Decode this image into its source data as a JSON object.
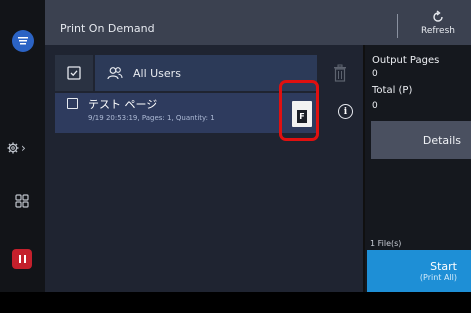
{
  "header": {
    "title": "Print On Demand",
    "refresh_label": "Refresh"
  },
  "rail": {
    "home_icon": "app-home-icon",
    "settings_icon": "gear-icon",
    "apps_icon": "apps-grid-icon",
    "stop_icon": "stop-pause-icon"
  },
  "toolbar": {
    "select_all_icon": "select-all-checkbox-icon",
    "user_filter_icon": "users-icon",
    "user_filter_label": "All Users",
    "delete_icon": "trash-icon"
  },
  "job": {
    "name": "テスト ページ",
    "details": "9/19 20:53:19, Pages: 1, Quantity: 1",
    "file_type": "F",
    "info_icon": "info-icon"
  },
  "summary": {
    "output_pages_label": "Output Pages",
    "output_pages_value": "0",
    "total_label": "Total (P)",
    "total_value": "0",
    "details_label": "Details",
    "file_count": "1 File(s)",
    "start_label": "Start",
    "start_sub": "(Print All)"
  },
  "colors": {
    "header_bg": "#3b4150",
    "job_row_bg": "#2e3b5e",
    "start_button": "#1e8fd6",
    "stop_button": "#c4202c",
    "highlight_box": "#e01010",
    "home_button": "#2b63c4"
  }
}
